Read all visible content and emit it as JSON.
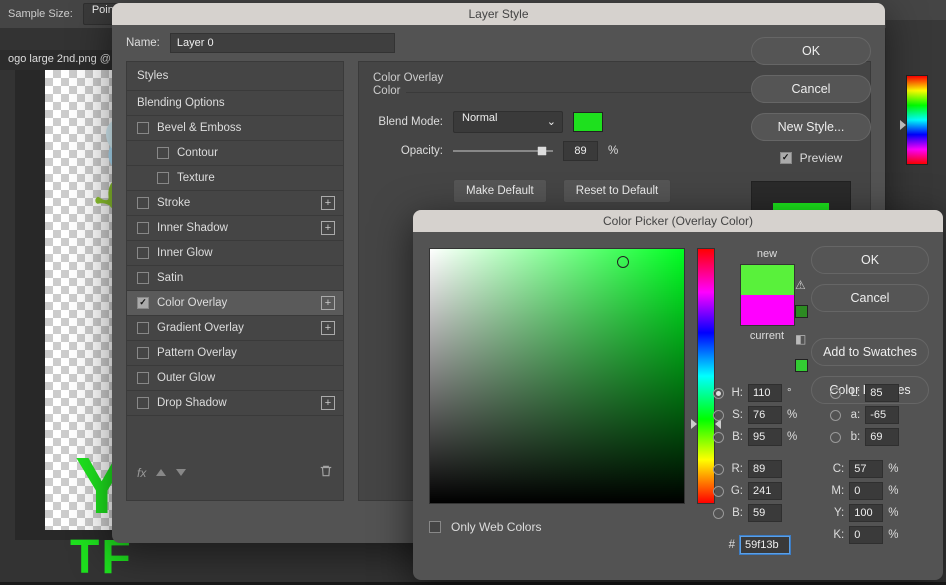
{
  "topbar": {
    "sample_size_label": "Sample Size:",
    "sample_size_value": "Point"
  },
  "doc_tab": "ogo large 2nd.png @",
  "layer_style": {
    "title": "Layer Style",
    "name_label": "Name:",
    "name_value": "Layer 0",
    "styles_header": "Styles",
    "blending_options": "Blending Options",
    "rows": {
      "bevel": "Bevel & Emboss",
      "contour": "Contour",
      "texture": "Texture",
      "stroke": "Stroke",
      "inner_shadow": "Inner Shadow",
      "inner_glow": "Inner Glow",
      "satin": "Satin",
      "color_overlay": "Color Overlay",
      "gradient_overlay": "Gradient Overlay",
      "pattern_overlay": "Pattern Overlay",
      "outer_glow": "Outer Glow",
      "drop_shadow": "Drop Shadow"
    },
    "fx_label": "fx",
    "main": {
      "section": "Color Overlay",
      "color_label": "Color",
      "blend_mode_label": "Blend Mode:",
      "blend_mode_value": "Normal",
      "opacity_label": "Opacity:",
      "opacity_value": "89",
      "opacity_pct": 89,
      "percent": "%",
      "make_default": "Make Default",
      "reset_default": "Reset to Default",
      "swatch_color": "#1ee01e"
    },
    "buttons": {
      "ok": "OK",
      "cancel": "Cancel",
      "new_style": "New Style...",
      "preview": "Preview"
    }
  },
  "color_picker": {
    "title": "Color Picker (Overlay Color)",
    "new_label": "new",
    "current_label": "current",
    "new_color": "#59f13b",
    "current_color": "#ff00ff",
    "buttons": {
      "ok": "OK",
      "cancel": "Cancel",
      "add_swatches": "Add to Swatches",
      "color_libraries": "Color Libraries"
    },
    "hsb": {
      "H": "110",
      "S": "76",
      "B": "95"
    },
    "lab": {
      "L": "85",
      "a": "-65",
      "b": "69"
    },
    "rgb": {
      "R": "89",
      "G": "241",
      "B": "59"
    },
    "cmyk": {
      "C": "57",
      "M": "0",
      "Y": "100",
      "K": "0"
    },
    "units": {
      "deg": "°",
      "pct": "%"
    },
    "hash": "#",
    "hex": "59f13b",
    "only_web": "Only Web Colors",
    "field_cursor": {
      "x_pct": 76,
      "y_pct": 5
    },
    "hue_arrow_pct": 69,
    "labels": {
      "H": "H:",
      "S": "S:",
      "B": "B:",
      "L": "L:",
      "a": "a:",
      "b": "b:",
      "R": "R:",
      "G": "G:",
      "Bl": "B:",
      "C": "C:",
      "M": "M:",
      "Y": "Y:",
      "K": "K:"
    }
  }
}
